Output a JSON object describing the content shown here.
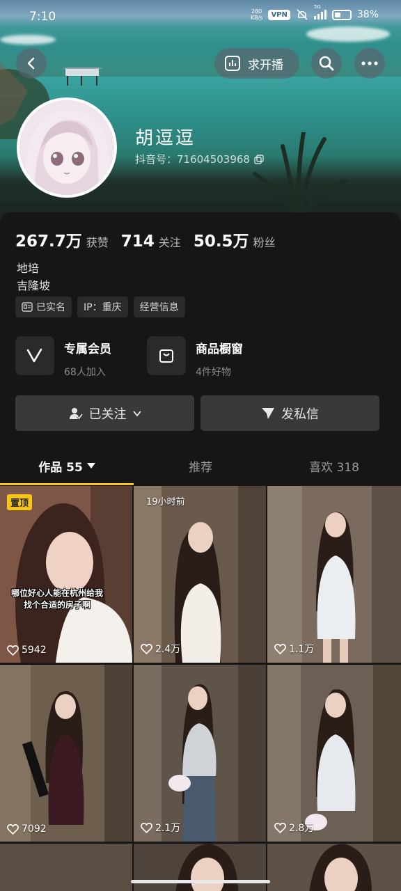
{
  "status_bar": {
    "time": "7:10",
    "net_speed_value": "280",
    "net_speed_unit": "KB/s",
    "vpn": "VPN",
    "network": "5G",
    "battery": "38%"
  },
  "header": {
    "back_icon": "chevron-left-icon",
    "live_request_label": "求开播",
    "search_icon": "search-icon",
    "more_icon": "more-icon"
  },
  "profile": {
    "nickname": "胡逗逗",
    "douyin_id": "抖音号：71604503968",
    "stats": [
      {
        "value": "267.7万",
        "label": "获赞"
      },
      {
        "value": "714",
        "label": "关注"
      },
      {
        "value": "50.5万",
        "label": "粉丝"
      }
    ],
    "bio_line1": "地培",
    "bio_line2": "吉隆坡",
    "tags": [
      "已实名",
      "IP：重庆",
      "经营信息"
    ]
  },
  "features": [
    {
      "title": "专属会员",
      "subtitle": "68人加入",
      "icon": "v-icon"
    },
    {
      "title": "商品橱窗",
      "subtitle": "4件好物",
      "icon": "shopping-bag-icon"
    }
  ],
  "actions": {
    "follow_label": "已关注",
    "message_label": "发私信"
  },
  "tabs": {
    "works": "作品 55",
    "recommend": "推荐",
    "likes": "喜欢 318"
  },
  "videos": [
    {
      "badge": "置顶",
      "caption_line1": "哪位好心人能在杭州给我",
      "caption_line2": "找个合适的房子啊",
      "likes": "5942",
      "bg": "#8a5a45"
    },
    {
      "time": "19小时前",
      "likes": "2.4万",
      "bg": "#6b5a4a"
    },
    {
      "likes": "1.1万",
      "bg": "#7a6a5c"
    },
    {
      "likes": "7092",
      "bg": "#6e5e4e"
    },
    {
      "likes": "2.1万",
      "bg": "#5e544a"
    },
    {
      "likes": "2.8万",
      "bg": "#6c6055"
    }
  ],
  "colors": {
    "accent": "#f5c518",
    "panel": "#161616",
    "button": "#393939"
  }
}
